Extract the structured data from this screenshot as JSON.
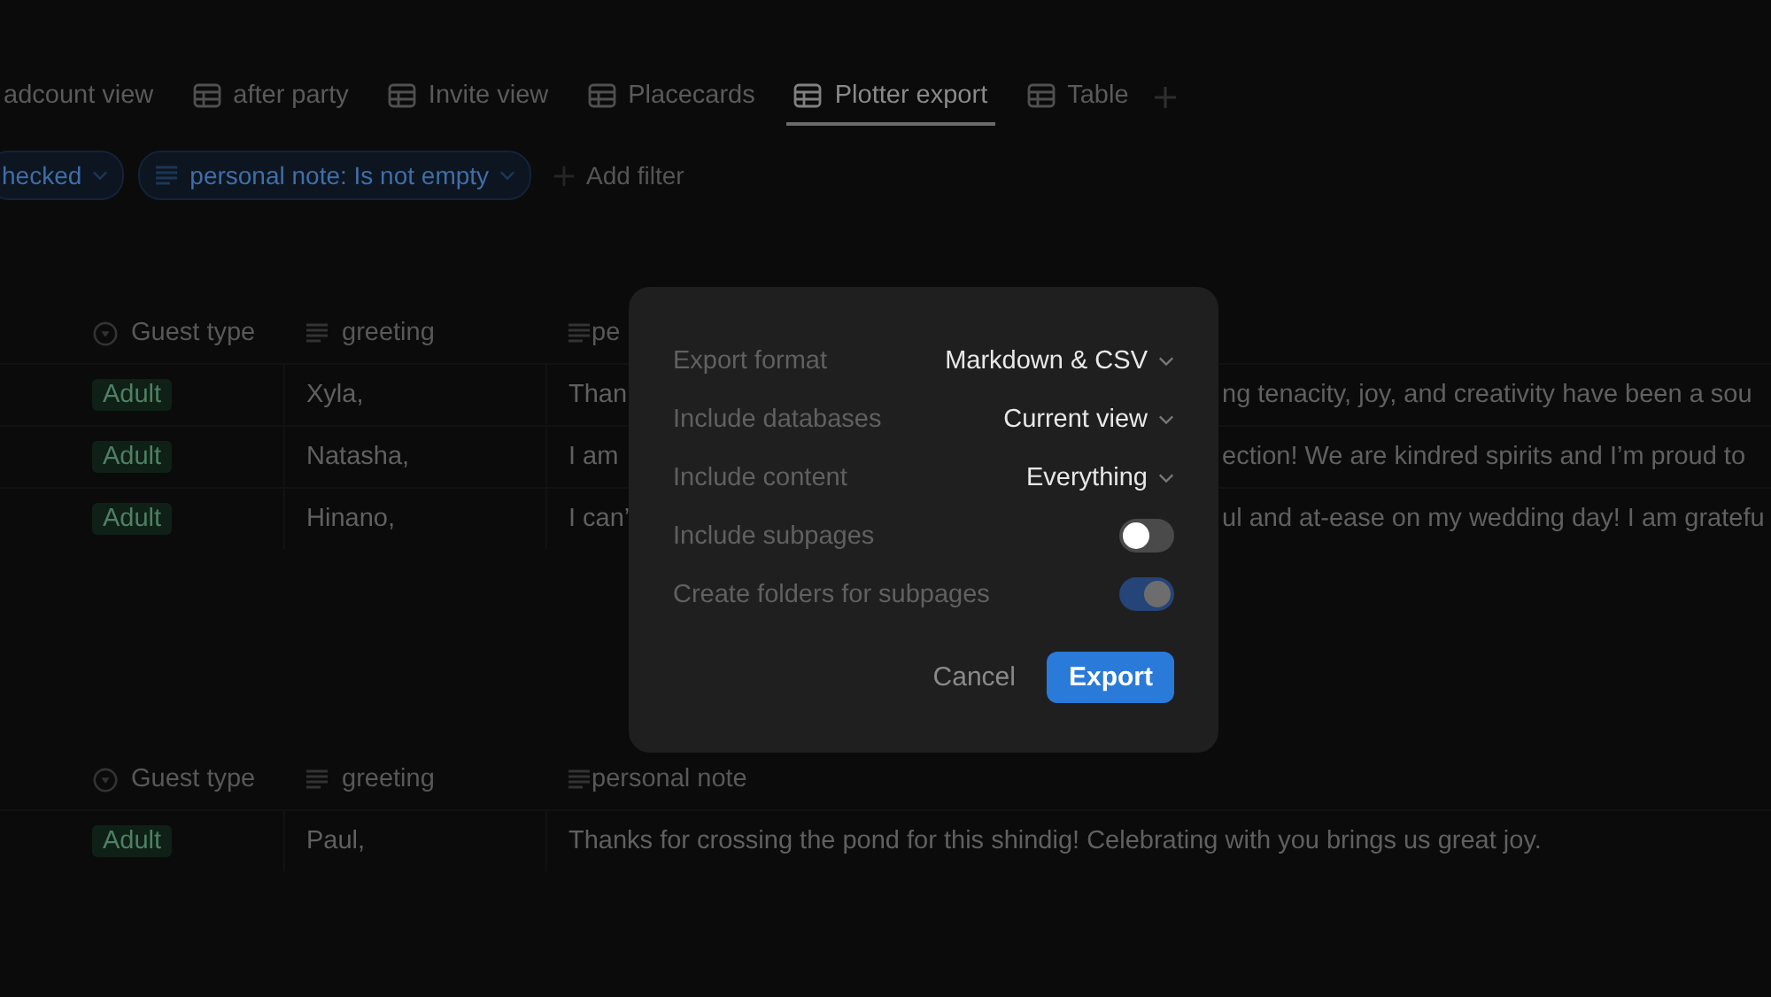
{
  "tabs": [
    {
      "label": "adcount view",
      "icon": false,
      "selected": false
    },
    {
      "label": "after party",
      "icon": true,
      "selected": false
    },
    {
      "label": "Invite view",
      "icon": true,
      "selected": false
    },
    {
      "label": "Placecards",
      "icon": true,
      "selected": false
    },
    {
      "label": "Plotter export",
      "icon": true,
      "selected": true
    },
    {
      "label": "Table",
      "icon": true,
      "selected": false
    }
  ],
  "filters": [
    {
      "kind": "plain",
      "label": "hecked"
    },
    {
      "kind": "text",
      "label": "personal note: Is not empty"
    },
    {
      "kind": "add",
      "label": "Add filter"
    }
  ],
  "tables": [
    {
      "columns": [
        {
          "kind": "select",
          "label": "Guest type"
        },
        {
          "kind": "text",
          "label": "greeting"
        },
        {
          "kind": "text",
          "label": "pe"
        }
      ],
      "rows": [
        {
          "guest_type": "Adult",
          "greeting": "Xyla,",
          "note_before": "Than",
          "note_after": "ng tenacity, joy, and creativity have been a sou"
        },
        {
          "guest_type": "Adult",
          "greeting": "Natasha,",
          "note_before": "I am",
          "note_after": "ection! We are kindred spirits and I’m proud to"
        },
        {
          "guest_type": "Adult",
          "greeting": "Hinano,",
          "note_before": "I can’",
          "note_after": "ul and at-ease on my wedding day! I am gratefu"
        }
      ]
    },
    {
      "columns": [
        {
          "kind": "select",
          "label": "Guest type"
        },
        {
          "kind": "text",
          "label": "greeting"
        },
        {
          "kind": "text",
          "label": "personal note"
        }
      ],
      "rows": [
        {
          "guest_type": "Adult",
          "greeting": "Paul,",
          "note_before": "Thanks for crossing the pond for this shindig! Celebrating with you brings us great joy."
        }
      ]
    }
  ],
  "dialog": {
    "settings": [
      {
        "kind": "select",
        "label": "Export format",
        "value": "Markdown & CSV"
      },
      {
        "kind": "select",
        "label": "Include databases",
        "value": "Current view"
      },
      {
        "kind": "select",
        "label": "Include content",
        "value": "Everything"
      },
      {
        "kind": "toggle",
        "label": "Include subpages",
        "on": false,
        "disabled": false
      },
      {
        "kind": "toggle",
        "label": "Create folders for subpages",
        "on": true,
        "disabled": true
      }
    ],
    "cancel": "Cancel",
    "confirm": "Export"
  }
}
